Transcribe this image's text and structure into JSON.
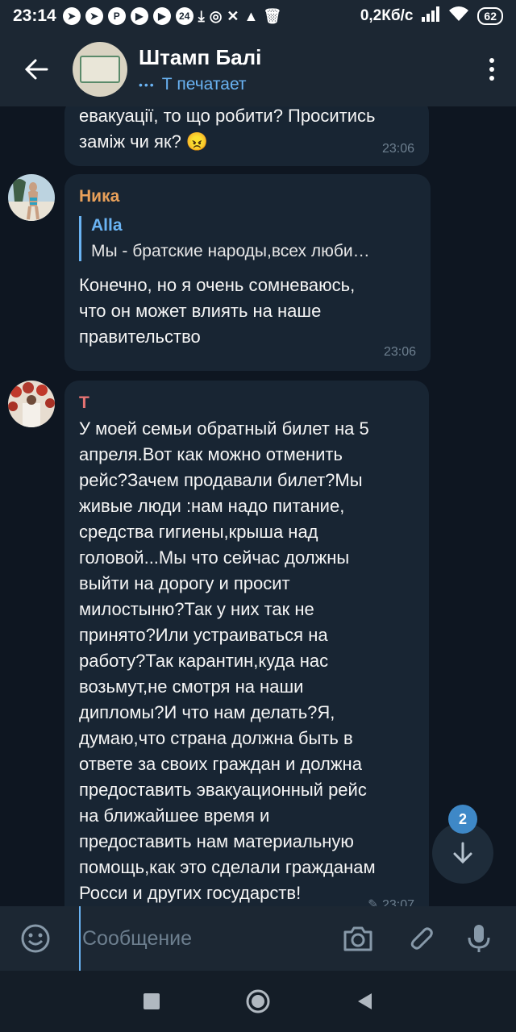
{
  "status_bar": {
    "time": "23:14",
    "notif_count": "24",
    "net_speed": "0,2Кб/с",
    "battery": "62"
  },
  "header": {
    "title": "Штамп Балі",
    "status_dots": "•••",
    "status": "Т печатает"
  },
  "messages": [
    {
      "text": "евакуації, то що робити? Проситись\nзаміж чи як? 😠",
      "time": "23:06"
    },
    {
      "sender": "Ника",
      "sender_color": "#e8a05a",
      "quote_author": "Alla",
      "quote_text": "Мы - братские народы,всех люби…",
      "text": "Конечно, но я очень сомневаюсь,\nчто он может влиять на наше\nправительство",
      "time": "23:06"
    },
    {
      "sender": "Т",
      "sender_color": "#e57373",
      "text": "У моей семьи обратный билет на 5\nапреля.Вот как можно отменить\nрейс?Зачем продавали билет?Мы\nживые люди :нам надо питание,\nсредства гигиены,крыша над\nголовой...Мы что сейчас должны\nвыйти на дорогу и просит\nмилостыню?Так у них так не\nпринято?Или устраиваться на\nработу?Так карантин,куда нас\nвозьмут,не смотря на наши\nдипломы?И что нам делать?Я,\nдумаю,что страна должна быть в\nответе за своих граждан и должна\nпредоставить эвакуационный рейс\nна ближайшее время и\nпредоставить нам материальную\nпомощь,как это сделали гражданам\nРосси и других государств!",
      "time": "23:07"
    }
  ],
  "scroll_badge": "2",
  "composer": {
    "placeholder": "Сообщение"
  },
  "icons": {
    "back": "arrow-left-icon",
    "menu": "more-vertical-icon",
    "emoji": "emoji-icon",
    "camera": "camera-icon",
    "attach": "paperclip-icon",
    "mic": "microphone-icon",
    "scroll_down": "arrow-down-icon"
  },
  "colors": {
    "background": "#0e1621",
    "bubble": "#182533",
    "accent": "#6ab3f3",
    "header": "#1c2733"
  }
}
